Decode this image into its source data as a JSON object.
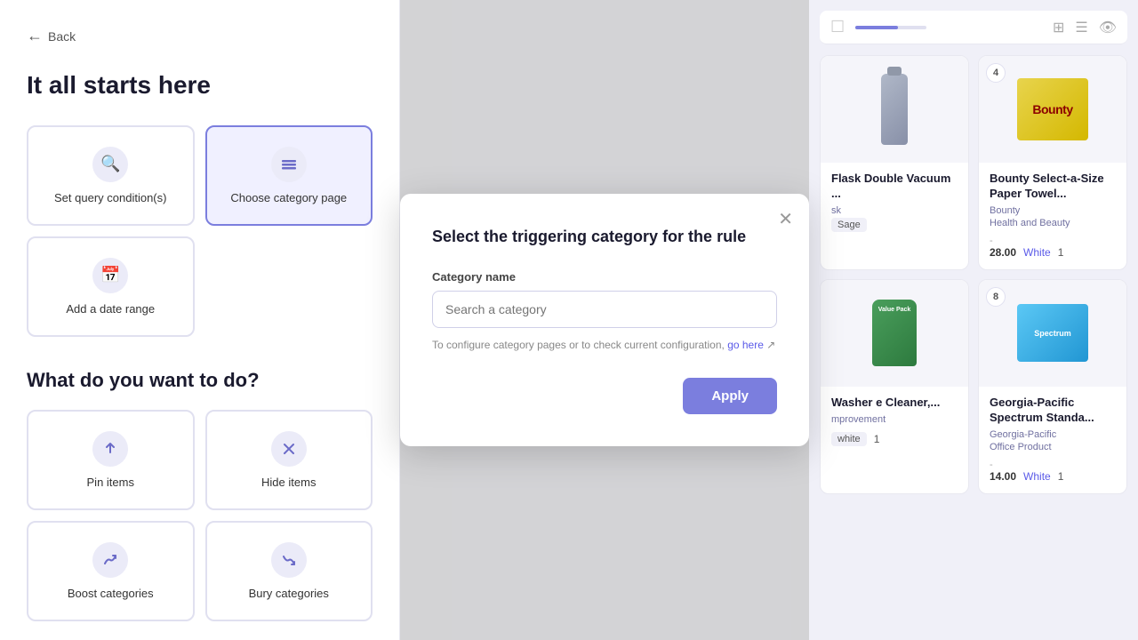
{
  "left": {
    "back_label": "Back",
    "hero_title": "It all starts here",
    "cards": [
      {
        "id": "set-query",
        "label": "Set query condition(s)",
        "icon": "🔍"
      },
      {
        "id": "choose-category",
        "label": "Choose category page",
        "icon": "≡",
        "active": true
      },
      {
        "id": "add-date",
        "label": "Add a date range",
        "icon": "📅"
      }
    ],
    "what_title": "What do you want to do?",
    "actions": [
      {
        "id": "pin-items",
        "label": "Pin items",
        "icon": "↑"
      },
      {
        "id": "hide-items",
        "label": "Hide items",
        "icon": "✕"
      },
      {
        "id": "boost-categories",
        "label": "Boost categories",
        "icon": "↗"
      },
      {
        "id": "bury-categories",
        "label": "Bury categories",
        "icon": "↘"
      }
    ]
  },
  "modal": {
    "title": "Select the triggering category for the rule",
    "field_label": "Category name",
    "search_placeholder": "Search a category",
    "helper_text": "To configure category pages or to check current configuration,",
    "helper_link": "go here",
    "apply_label": "Apply"
  },
  "right": {
    "products": [
      {
        "id": "hydro-flask",
        "name": "Flask Double Vacuum ...",
        "brand": "sk",
        "category": "Sage",
        "price": "",
        "color": "",
        "qty": "",
        "type": "flask"
      },
      {
        "id": "bounty",
        "badge": "4",
        "name": "Bounty Select-a-Size Paper Towel...",
        "brand": "Bounty",
        "category": "Health and Beauty",
        "dash": "-",
        "price": "28.00",
        "color": "White",
        "qty": "1",
        "type": "bounty"
      },
      {
        "id": "cleaner",
        "name": "Washer e Cleaner,...",
        "brand": "",
        "category": "mprovement",
        "dash": "",
        "price": "",
        "color": "white",
        "qty": "1",
        "type": "cleaner"
      },
      {
        "id": "spectrum",
        "badge": "8",
        "name": "Georgia-Pacific Spectrum Standa...",
        "brand": "Georgia-Pacific",
        "category": "Office Product",
        "dash": "-",
        "price": "14.00",
        "color": "White",
        "qty": "1",
        "type": "spectrum"
      }
    ]
  }
}
